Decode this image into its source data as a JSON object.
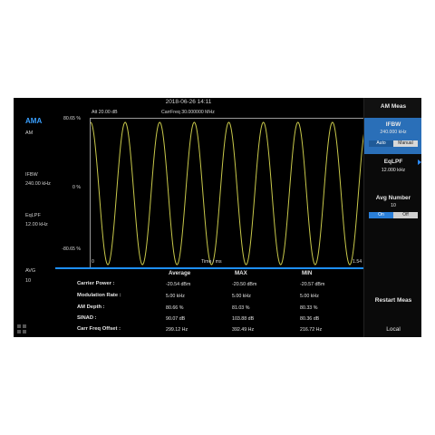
{
  "header": {
    "datetime": "2018-06-26 14:11"
  },
  "status": {
    "att": "Att   20.00 dB",
    "carrfreq": "CarrFreq     30.000000 MHz"
  },
  "left_panel": {
    "mode": "AMA",
    "sub": "AM",
    "ifbw_label": "IFBW",
    "ifbw_value": "240.00 kHz",
    "eqlpf_label": "EqLPF",
    "eqlpf_value": "12.00 kHz",
    "avg_label": "AVG",
    "avg_value": "10"
  },
  "plot": {
    "y_top": "80.65 %",
    "y_mid": "0 %",
    "y_bottom": "-80.65 %",
    "x_start": "0",
    "x_label": "Time / ms",
    "x_end": "1.54"
  },
  "chart_data": {
    "type": "line",
    "xlabel": "Time / ms",
    "xlim": [
      0,
      1.54
    ],
    "ylim": [
      -80.65,
      80.65
    ],
    "y_unit": "%",
    "series": [
      {
        "amplitude": 80.66,
        "cycles": 8,
        "start_phase": "peak-to-trough",
        "color": "#c8c84a"
      }
    ],
    "grid": false
  },
  "results": {
    "headers": [
      "Average",
      "MAX",
      "MIN"
    ],
    "rows": [
      {
        "label": "Carrier Power :",
        "avg": "-20.54 dBm",
        "max": "-20.50 dBm",
        "min": "-20.57 dBm"
      },
      {
        "label": "Modulation Rate :",
        "avg": "5.00 kHz",
        "max": "5.00 kHz",
        "min": "5.00 kHz"
      },
      {
        "label": "AM Depth :",
        "avg": "80.66 %",
        "max": "81.03 %",
        "min": "80.33 %"
      },
      {
        "label": "SINAD :",
        "avg": "90.07 dB",
        "max": "103.88 dB",
        "min": "80.36 dB"
      },
      {
        "label": "Carr Freq Offset :",
        "avg": "299.12 Hz",
        "max": "392.49 Hz",
        "min": "216.72 Hz"
      }
    ]
  },
  "softkeys": {
    "menu_title": "AM Meas",
    "ifbw": {
      "title": "IFBW",
      "value": "240.000 kHz",
      "opt_auto": "Auto",
      "opt_manual": "Manual"
    },
    "eqlpf": {
      "title": "EqLPF",
      "value": "12.000 kHz"
    },
    "avg_number": {
      "title": "Avg Number",
      "value": "10",
      "opt_on": "On",
      "opt_off": "Off"
    },
    "restart": "Restart Meas",
    "local": "Local"
  },
  "colors": {
    "accent": "#1e8fff",
    "trace": "#c8c84a",
    "softkey_active": "#2a6fb8"
  }
}
